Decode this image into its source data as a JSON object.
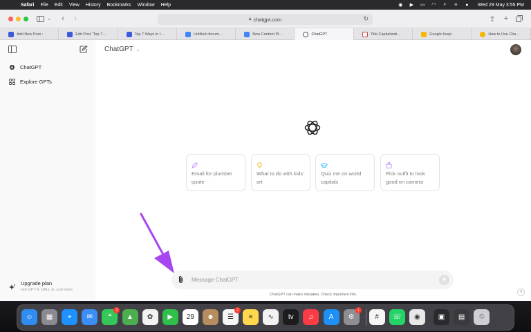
{
  "menubar": {
    "app_name": "Safari",
    "menus": [
      "File",
      "Edit",
      "View",
      "History",
      "Bookmarks",
      "Window",
      "Help"
    ],
    "clock": "Wed 29 May  3:55 PM"
  },
  "browser": {
    "url": "chatgpt.com",
    "tabs": [
      {
        "label": "Add New Post ‹",
        "favicon_color": "#3b5bdb",
        "active": false
      },
      {
        "label": "Edit Post “Top 7…",
        "favicon_color": "#3b5bdb",
        "active": false
      },
      {
        "label": "Top 7 Ways to I…",
        "favicon_color": "#3b5bdb",
        "active": false
      },
      {
        "label": "Untitled docum…",
        "favicon_color": "#4285f4",
        "active": false
      },
      {
        "label": "New Content Pl…",
        "favicon_color": "#4285f4",
        "active": false
      },
      {
        "label": "ChatGPT",
        "favicon_color": "#555555",
        "active": true
      },
      {
        "label": "Title Capitalizati…",
        "favicon_color": "#e8e8e8",
        "active": false
      },
      {
        "label": "Google Keep",
        "favicon_color": "#f9b806",
        "active": false
      },
      {
        "label": "How to Use Cha…",
        "favicon_color": "#f4b400",
        "active": false
      }
    ]
  },
  "sidebar": {
    "items": [
      {
        "label": "ChatGPT",
        "icon": "openai-icon"
      },
      {
        "label": "Explore GPTs",
        "icon": "grid-icon"
      }
    ],
    "upgrade": {
      "title": "Upgrade plan",
      "subtitle": "Get GPT-4, DALL·E, and more"
    }
  },
  "main": {
    "model_selector": "ChatGPT",
    "suggestions": [
      {
        "text": "Email for plumber quote",
        "icon": "pen-icon",
        "icon_color": "#c084fc"
      },
      {
        "text": "What to do with kids' art",
        "icon": "lightbulb-icon",
        "icon_color": "#eab308"
      },
      {
        "text": "Quiz me on world capitals",
        "icon": "graduation-cap-icon",
        "icon_color": "#38bdf8"
      },
      {
        "text": "Pick outfit to look good on camera",
        "icon": "shopping-bag-icon",
        "icon_color": "#c084fc"
      }
    ],
    "input_placeholder": "Message ChatGPT",
    "disclaimer": "ChatGPT can make mistakes. Check important info.",
    "help_label": "?"
  },
  "annotation": {
    "arrow_color": "#a745f0"
  },
  "dock": {
    "apps": [
      {
        "name": "Finder",
        "color": "#2f8cf0",
        "glyph": "☺"
      },
      {
        "name": "Launchpad",
        "color": "#8a8a90",
        "glyph": "▦"
      },
      {
        "name": "Safari",
        "color": "#1e90ff",
        "glyph": "⌖"
      },
      {
        "name": "Mail",
        "color": "#3a8ef6",
        "glyph": "✉"
      },
      {
        "name": "Messages",
        "color": "#34c759",
        "glyph": "❝",
        "badge": "2"
      },
      {
        "name": "Maps",
        "color": "#4cae4f",
        "glyph": "▲"
      },
      {
        "name": "Photos",
        "color": "#f2f2f2",
        "glyph": "✿"
      },
      {
        "name": "FaceTime",
        "color": "#2fbf4a",
        "glyph": "▶"
      },
      {
        "name": "Calendar",
        "color": "#ffffff",
        "glyph": "29"
      },
      {
        "name": "Contacts",
        "color": "#b58d5e",
        "glyph": "☻"
      },
      {
        "name": "Reminders",
        "color": "#f5f5f5",
        "glyph": "☰",
        "badge": "2"
      },
      {
        "name": "Notes",
        "color": "#ffd84d",
        "glyph": "≡"
      },
      {
        "name": "Freeform",
        "color": "#f2f2f2",
        "glyph": "∿"
      },
      {
        "name": "TV",
        "color": "#1c1c1e",
        "glyph": "tv"
      },
      {
        "name": "Music",
        "color": "#fc3c44",
        "glyph": "♫"
      },
      {
        "name": "App Store",
        "color": "#1e8ff5",
        "glyph": "A"
      },
      {
        "name": "System Settings",
        "color": "#8e8e93",
        "glyph": "⚙",
        "badge": "1"
      },
      {
        "name": "Slack",
        "color": "#f5f5f5",
        "glyph": "#"
      },
      {
        "name": "WhatsApp",
        "color": "#25d366",
        "glyph": "☏"
      },
      {
        "name": "Chrome",
        "color": "#e8e8e8",
        "glyph": "◉"
      },
      {
        "name": "Screenshot",
        "color": "#2a2a2e",
        "glyph": "▣"
      },
      {
        "name": "Preview",
        "color": "#3a3a3e",
        "glyph": "▤"
      },
      {
        "name": "Trash",
        "color": "#cfcfd3",
        "glyph": "♲"
      }
    ]
  }
}
